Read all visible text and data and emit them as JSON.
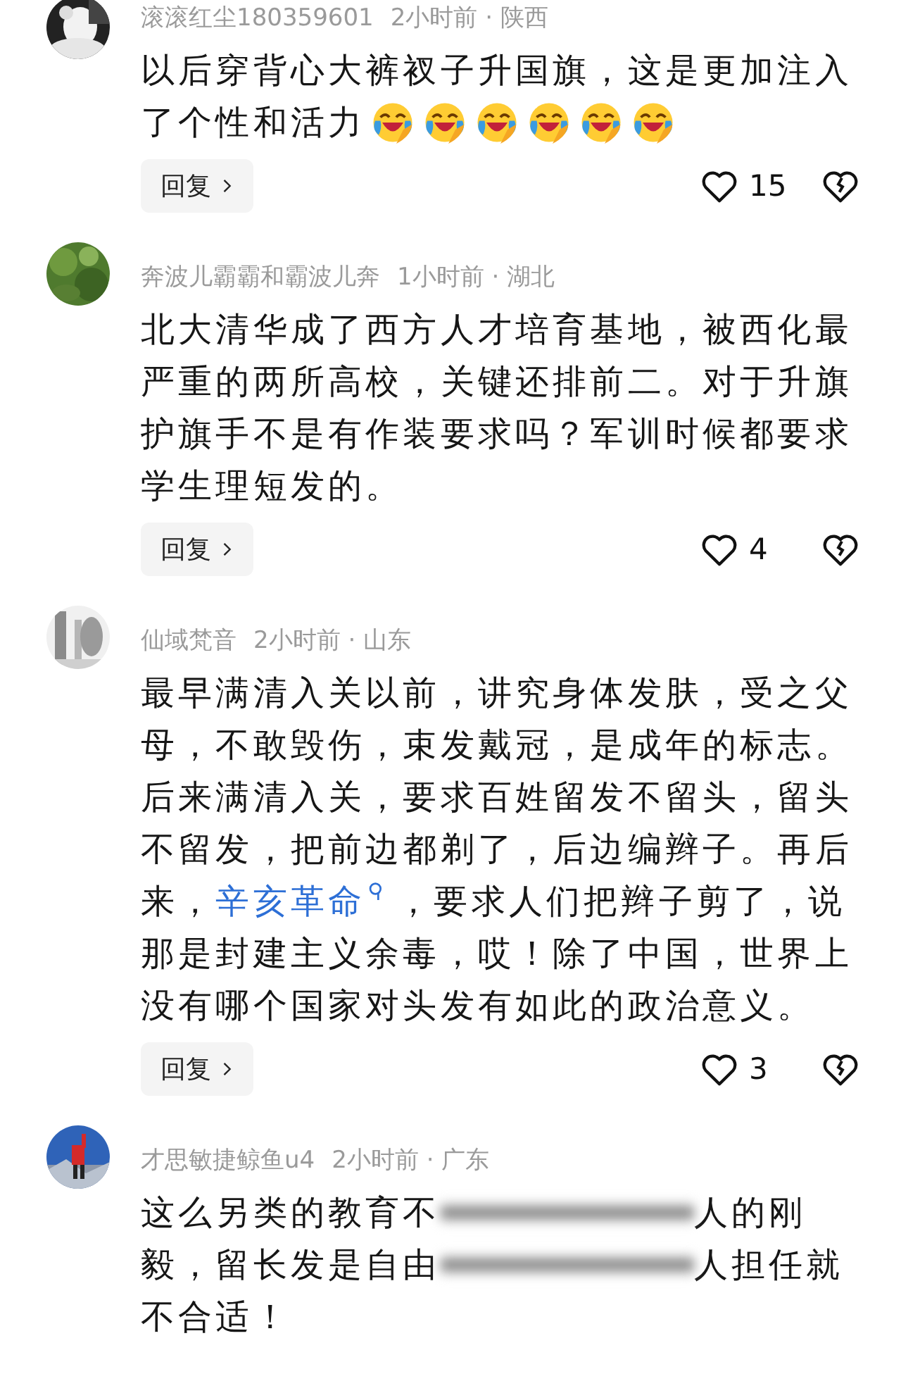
{
  "comments": [
    {
      "avatar": {
        "kind": "picture"
      },
      "name": "滚滚红尘180359601",
      "meta": "2小时前 · 陕西",
      "lines": [
        [
          {
            "kind": "text",
            "text": "以后穿背心大裤衩子升国旗，这是更加注入"
          }
        ],
        [
          {
            "kind": "text",
            "text": "了个性和活力"
          },
          {
            "kind": "emoji"
          },
          {
            "kind": "emoji"
          },
          {
            "kind": "emoji"
          },
          {
            "kind": "emoji"
          },
          {
            "kind": "emoji"
          },
          {
            "kind": "emoji"
          }
        ]
      ],
      "reply": "回复",
      "likes": "15"
    },
    {
      "avatar": {
        "kind": "picture"
      },
      "name": "奔波儿霸霸和霸波儿奔",
      "meta": "1小时前 · 湖北",
      "lines": [
        [
          {
            "kind": "text",
            "text": "北大清华成了西方人才培育基地，被西化最"
          }
        ],
        [
          {
            "kind": "text",
            "text": "严重的两所高校，关键还排前二。对于升旗"
          }
        ],
        [
          {
            "kind": "text",
            "text": "护旗手不是有作装要求吗？军训时候都要求"
          }
        ],
        [
          {
            "kind": "text",
            "text": "学生理短发的。"
          }
        ]
      ],
      "reply": "回复",
      "likes": "4"
    },
    {
      "avatar": {
        "kind": "picture"
      },
      "name": "仙域梵音",
      "meta": "2小时前 · 山东",
      "lines": [
        [
          {
            "kind": "text",
            "text": "最早满清入关以前，讲究身体发肤，受之父"
          }
        ],
        [
          {
            "kind": "text",
            "text": "母，不敢毁伤，束发戴冠，是成年的标志。"
          }
        ],
        [
          {
            "kind": "text",
            "text": "后来满清入关，要求百姓留发不留头，留头"
          }
        ],
        [
          {
            "kind": "text",
            "text": "不留发，把前边都剃了，后边编辫子。再后"
          }
        ],
        [
          {
            "kind": "text",
            "text": "来，"
          },
          {
            "kind": "link",
            "text": "辛亥革命"
          },
          {
            "kind": "text",
            "text": "，要求人们把辫子剪了，说"
          }
        ],
        [
          {
            "kind": "text",
            "text": "那是封建主义余毒，哎！除了中国，世界上"
          }
        ],
        [
          {
            "kind": "text",
            "text": "没有哪个国家对头发有如此的政治意义。"
          }
        ]
      ],
      "reply": "回复",
      "likes": "3"
    },
    {
      "avatar": {
        "kind": "picture"
      },
      "name": "才思敏捷鲸鱼u4",
      "meta": "2小时前 · 广东",
      "lines": [
        [
          {
            "kind": "text",
            "text": "这么另类的教育不"
          },
          {
            "kind": "blur"
          },
          {
            "kind": "text",
            "text": "人的刚"
          }
        ],
        [
          {
            "kind": "text",
            "text": "毅，留长发是自由"
          },
          {
            "kind": "blur"
          },
          {
            "kind": "text",
            "text": "人担任就"
          }
        ],
        [
          {
            "kind": "text",
            "text": "不合适！"
          }
        ]
      ]
    }
  ]
}
